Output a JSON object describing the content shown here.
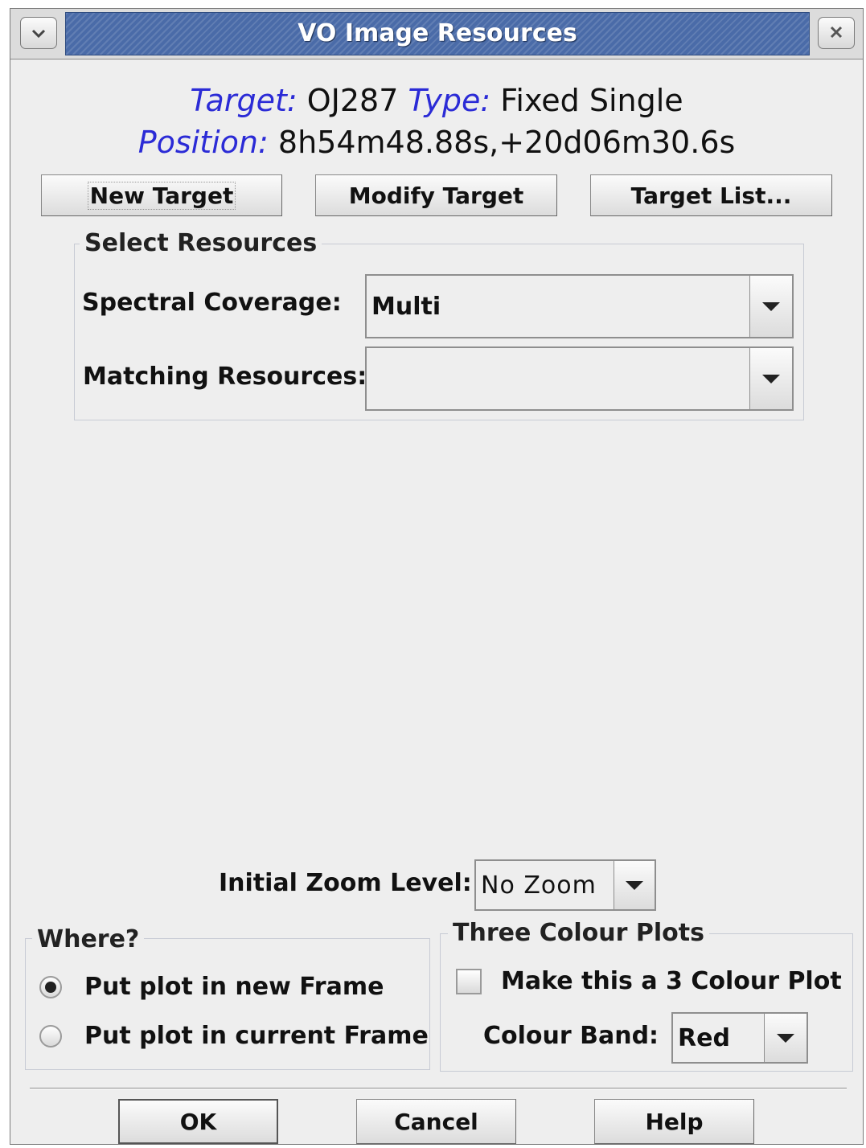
{
  "window": {
    "title": "VO Image Resources",
    "menu_icon": "chevron-down-icon",
    "close_icon": "close-icon"
  },
  "target_info": {
    "target_label": "Target:",
    "target_value": "OJ287",
    "type_label": "Type:",
    "type_value": "Fixed Single",
    "position_label": "Position:",
    "position_value": "8h54m48.88s,+20d06m30.6s"
  },
  "target_buttons": {
    "new_target": "New Target",
    "modify_target": "Modify Target",
    "target_list": "Target List..."
  },
  "select_resources": {
    "title": "Select Resources",
    "spectral_label": "Spectral Coverage:",
    "spectral_value": "Multi",
    "matching_label": "Matching Resources:",
    "matching_value": ""
  },
  "zoom": {
    "label": "Initial Zoom Level:",
    "value": "No Zoom"
  },
  "where": {
    "title": "Where?",
    "options": [
      "Put plot in new Frame",
      "Put plot in current Frame"
    ],
    "selected": "Put plot in new Frame"
  },
  "three_colour": {
    "title": "Three Colour Plots",
    "checkbox_label": "Make this a 3 Colour Plot",
    "checked": false,
    "band_label": "Colour Band:",
    "band_value": "Red"
  },
  "dialog_buttons": {
    "ok": "OK",
    "cancel": "Cancel",
    "help": "Help"
  },
  "colors": {
    "titlebar": "#4a6ba8",
    "label_italic": "#2b2bd6",
    "background": "#eeeeee"
  }
}
